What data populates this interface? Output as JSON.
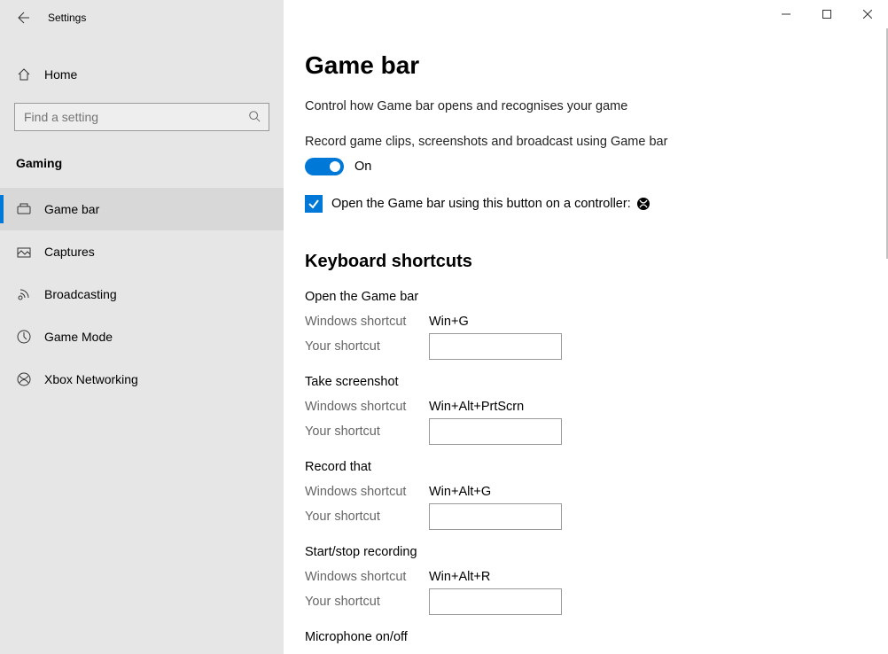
{
  "app": {
    "title": "Settings"
  },
  "sidebar": {
    "home": "Home",
    "searchPlaceholder": "Find a setting",
    "category": "Gaming",
    "items": [
      {
        "label": "Game bar"
      },
      {
        "label": "Captures"
      },
      {
        "label": "Broadcasting"
      },
      {
        "label": "Game Mode"
      },
      {
        "label": "Xbox Networking"
      }
    ]
  },
  "page": {
    "title": "Game bar",
    "intro": "Control how Game bar opens and recognises your game",
    "toggle": {
      "label": "Record game clips, screenshots and broadcast using Game bar",
      "state": "On"
    },
    "checkbox": {
      "label": "Open the Game bar using this button on a controller:"
    },
    "shortcutsTitle": "Keyboard shortcuts",
    "labels": {
      "winShortcut": "Windows shortcut",
      "yourShortcut": "Your shortcut"
    },
    "shortcuts": [
      {
        "name": "Open the Game bar",
        "win": "Win+G"
      },
      {
        "name": "Take screenshot",
        "win": "Win+Alt+PrtScrn"
      },
      {
        "name": "Record that",
        "win": "Win+Alt+G"
      },
      {
        "name": "Start/stop recording",
        "win": "Win+Alt+R"
      },
      {
        "name": "Microphone on/off",
        "win": ""
      }
    ]
  }
}
